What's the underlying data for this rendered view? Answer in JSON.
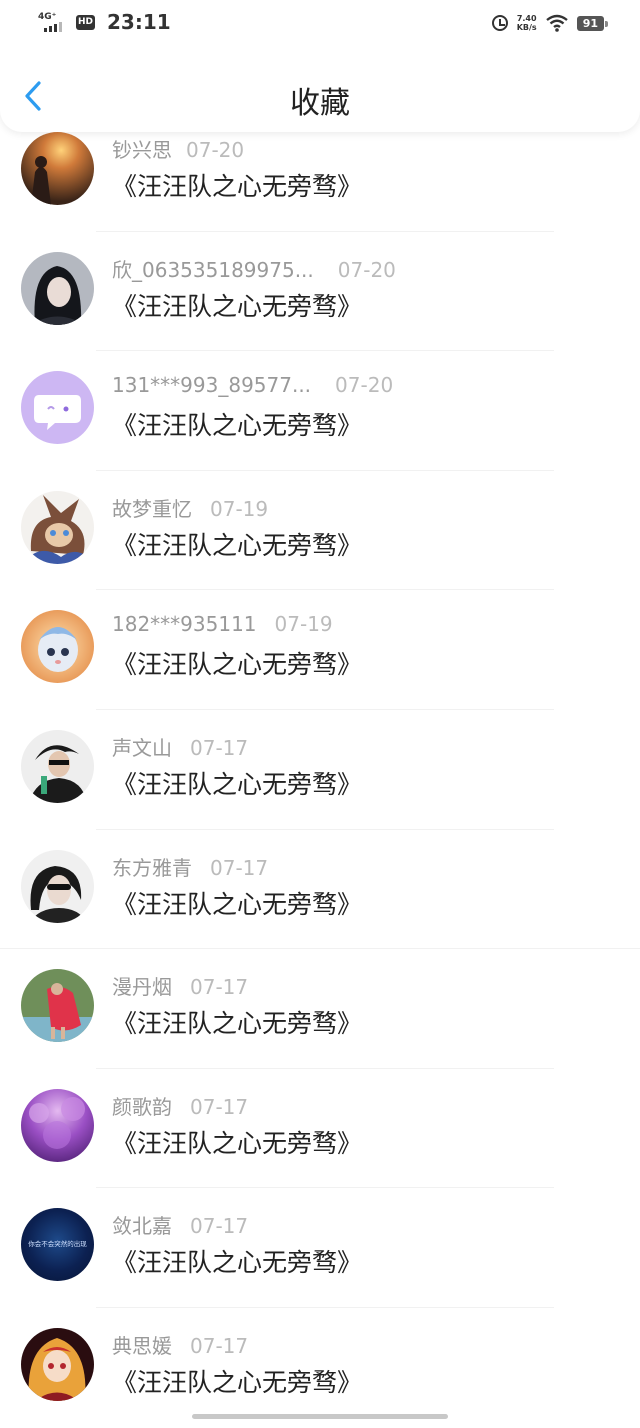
{
  "status_bar": {
    "network": "4G⁺",
    "hd": "HD",
    "time": "23:11",
    "speed_value": "7.40",
    "speed_unit": "KB/s",
    "battery": "91"
  },
  "header": {
    "back_icon": "chevron-left-icon",
    "title": "收藏"
  },
  "colors": {
    "accent": "#2d9cf0",
    "title_text": "#222222",
    "meta_text": "#999999"
  },
  "items": [
    {
      "user": "钞兴思",
      "date": "07-20",
      "title": "《汪汪队之心无旁骛》"
    },
    {
      "user": "欣_063535189975...",
      "date": "07-20",
      "title": "《汪汪队之心无旁骛》"
    },
    {
      "user": "131***993_89577...",
      "date": "07-20",
      "title": "《汪汪队之心无旁骛》"
    },
    {
      "user": "故梦重忆",
      "date": "07-19",
      "title": "《汪汪队之心无旁骛》"
    },
    {
      "user": "182***935111",
      "date": "07-19",
      "title": "《汪汪队之心无旁骛》"
    },
    {
      "user": "声文山",
      "date": "07-17",
      "title": "《汪汪队之心无旁骛》"
    },
    {
      "user": "东方雅青",
      "date": "07-17",
      "title": "《汪汪队之心无旁骛》"
    },
    {
      "user": "漫丹烟",
      "date": "07-17",
      "title": "《汪汪队之心无旁骛》"
    },
    {
      "user": "颜歌韵",
      "date": "07-17",
      "title": "《汪汪队之心无旁骛》"
    },
    {
      "user": "敛北嘉",
      "date": "07-17",
      "title": "《汪汪队之心无旁骛》",
      "avatar_text": "你会不会突然的出现"
    },
    {
      "user": "典思媛",
      "date": "07-17",
      "title": "《汪汪队之心无旁骛》"
    }
  ]
}
